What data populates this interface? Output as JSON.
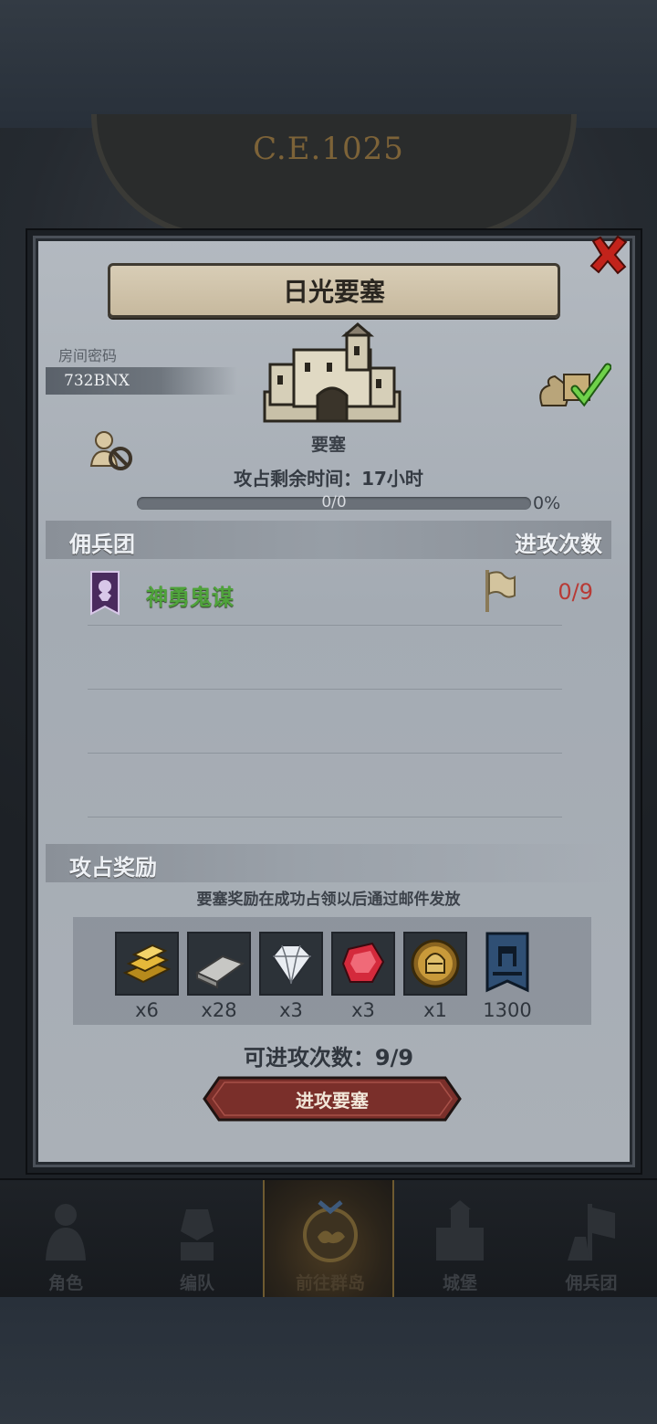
{
  "background": {
    "era": "C.E.1025"
  },
  "dialog": {
    "title": "日光要塞",
    "close_icon": "close-x-icon",
    "room": {
      "label": "房间密码",
      "code": "732BNX"
    },
    "fortress": {
      "type_label": "要塞",
      "time_remaining": "攻占剩余时间：17小时",
      "progress_text": "0/0",
      "progress_percent_text": "0%",
      "progress_fraction": 0
    },
    "mercenary_section": {
      "left_header": "佣兵团",
      "right_header": "进攻次数",
      "rows": [
        {
          "guild_name": "神勇鬼谋",
          "attacks": "0/9"
        }
      ]
    },
    "reward_section": {
      "header": "攻占奖励",
      "note": "要塞奖励在成功占领以后通过邮件发放",
      "items": [
        {
          "icon": "gold-bar-icon",
          "qty": "x6"
        },
        {
          "icon": "silver-bar-icon",
          "qty": "x28"
        },
        {
          "icon": "diamond-icon",
          "qty": "x3"
        },
        {
          "icon": "ruby-icon",
          "qty": "x3"
        },
        {
          "icon": "knight-medal-icon",
          "qty": "x1"
        },
        {
          "icon": "guild-banner-icon",
          "qty": "1300"
        }
      ]
    },
    "attacks_available": "可进攻次数：9/9",
    "attack_button": "进攻要塞"
  },
  "bottom_nav": {
    "items": [
      {
        "label": "角色",
        "icon": "character-icon",
        "active": false
      },
      {
        "label": "编队",
        "icon": "formation-icon",
        "active": false
      },
      {
        "label": "前往群岛",
        "icon": "islands-icon",
        "active": true
      },
      {
        "label": "城堡",
        "icon": "castle-icon",
        "active": false
      },
      {
        "label": "佣兵团",
        "icon": "mercenary-icon",
        "active": false
      }
    ]
  },
  "colors": {
    "guild_name": "#4fa33b",
    "attack_count": "#b83a35",
    "close": "#c2231b",
    "button": "#7a2f2a"
  }
}
